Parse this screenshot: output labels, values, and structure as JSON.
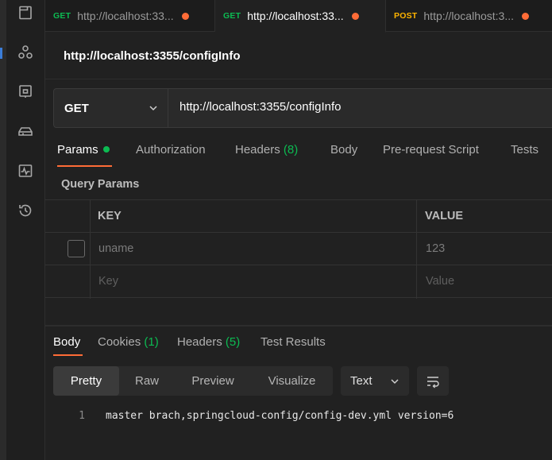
{
  "tabs": [
    {
      "method": "GET",
      "method_color": "#0cbb52",
      "title": "http://localhost:33...",
      "unsaved": true,
      "active": false
    },
    {
      "method": "GET",
      "method_color": "#0cbb52",
      "title": "http://localhost:33...",
      "unsaved": true,
      "active": true
    },
    {
      "method": "POST",
      "method_color": "#ffb400",
      "title": "http://localhost:3...",
      "unsaved": true,
      "active": false
    }
  ],
  "request": {
    "title": "http://localhost:3355/configInfo",
    "method": "GET",
    "url": "http://localhost:3355/configInfo"
  },
  "request_tabs": {
    "params": "Params",
    "authorization": "Authorization",
    "headers": "Headers",
    "headers_count": "(8)",
    "body": "Body",
    "prerequest": "Pre-request Script",
    "tests": "Tests"
  },
  "query_params": {
    "label": "Query Params",
    "key_header": "KEY",
    "value_header": "VALUE",
    "rows": [
      {
        "key": "uname",
        "value": "123"
      }
    ],
    "placeholder_key": "Key",
    "placeholder_value": "Value"
  },
  "response_tabs": {
    "body": "Body",
    "cookies": "Cookies",
    "cookies_count": "(1)",
    "headers": "Headers",
    "headers_count": "(5)",
    "test_results": "Test Results"
  },
  "response_view": {
    "modes": [
      "Pretty",
      "Raw",
      "Preview",
      "Visualize"
    ],
    "active_mode": "Pretty",
    "format": "Text"
  },
  "response_body": {
    "line_number": "1",
    "text": "master brach,springcloud-config/config-dev.yml version=6"
  },
  "colors": {
    "accent": "#ff6c37",
    "success": "#0cbb52",
    "post": "#ffb400"
  },
  "icons": [
    "collections-icon",
    "apis-icon",
    "environments-icon",
    "mock-servers-icon",
    "monitors-icon",
    "history-icon"
  ]
}
